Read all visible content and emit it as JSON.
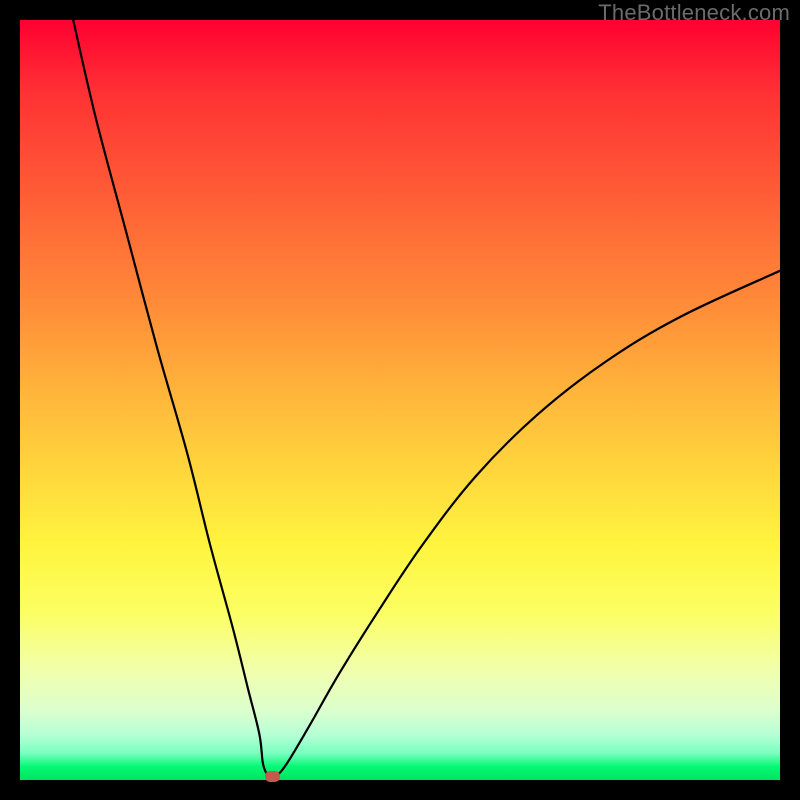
{
  "watermark": "TheBottleneck.com",
  "colors": {
    "frame": "#000000",
    "curve": "#000000",
    "marker": "#c25a4d"
  },
  "chart_data": {
    "type": "line",
    "title": "",
    "xlabel": "",
    "ylabel": "",
    "xlim": [
      0,
      100
    ],
    "ylim": [
      0,
      100
    ],
    "grid": false,
    "legend": false,
    "series": [
      {
        "name": "bottleneck-curve",
        "x": [
          7,
          10,
          14,
          18,
          22,
          25,
          28,
          30,
          31.5,
          32,
          32.8,
          33.6,
          35,
          38,
          42,
          47,
          53,
          60,
          68,
          77,
          87,
          100
        ],
        "values": [
          100,
          87,
          72,
          57,
          43,
          31,
          20,
          12,
          6,
          2,
          0.5,
          0.5,
          2,
          7,
          14,
          22,
          31,
          40,
          48,
          55,
          61,
          67
        ]
      }
    ],
    "marker": {
      "x": 33.2,
      "y": 0.5
    },
    "gradient_reference": "green (0%) → yellow (~70%) → red (100%)"
  }
}
